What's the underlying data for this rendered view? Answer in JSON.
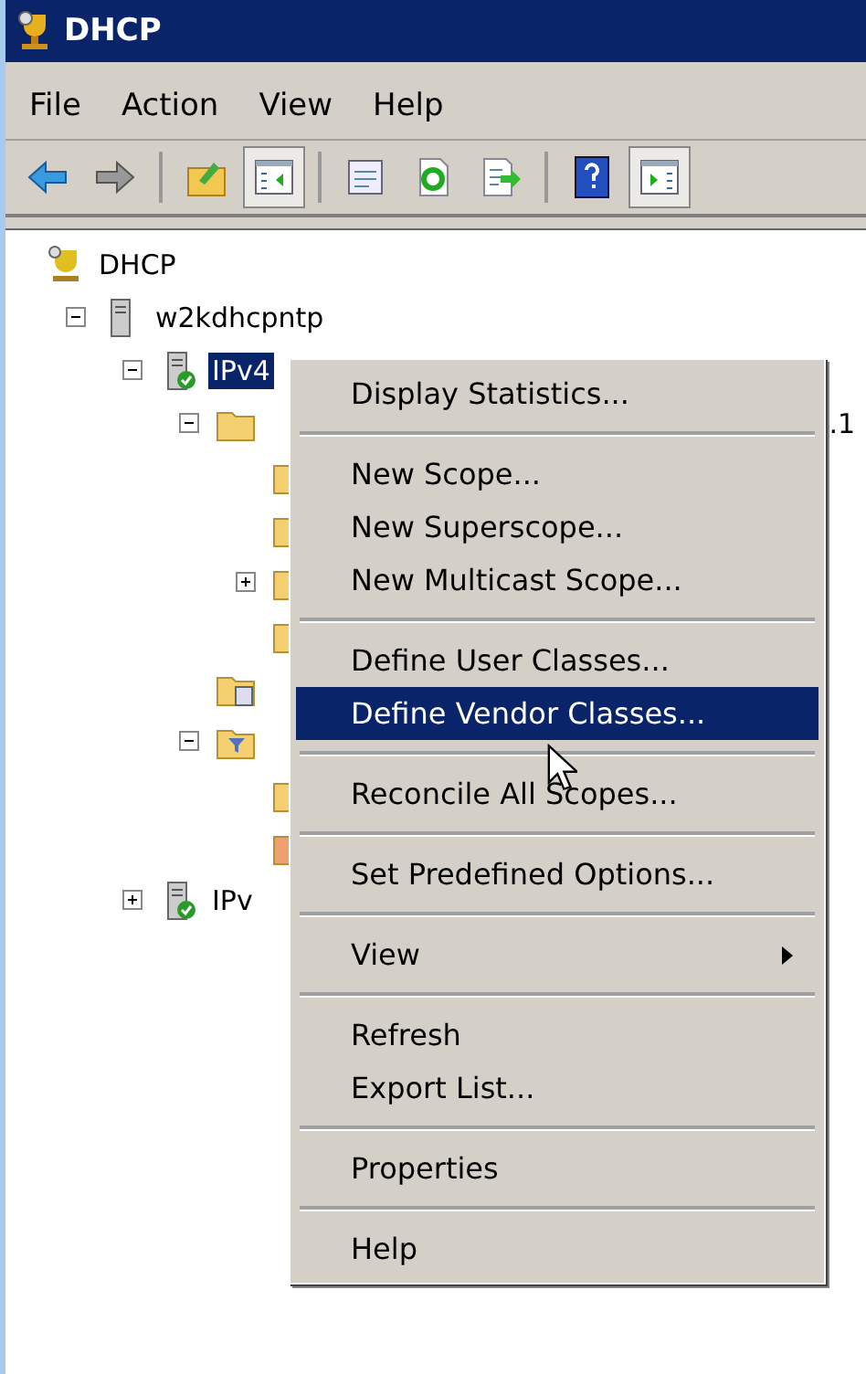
{
  "window": {
    "title": "DHCP"
  },
  "menu_bar": [
    "File",
    "Action",
    "View",
    "Help"
  ],
  "toolbar": [
    {
      "kind": "back",
      "pressed": false
    },
    {
      "kind": "forward",
      "pressed": false
    },
    {
      "kind": "separator"
    },
    {
      "kind": "up",
      "pressed": false
    },
    {
      "kind": "tree",
      "pressed": true
    },
    {
      "kind": "separator"
    },
    {
      "kind": "properties",
      "pressed": false
    },
    {
      "kind": "refresh",
      "pressed": false
    },
    {
      "kind": "export",
      "pressed": false
    },
    {
      "kind": "separator"
    },
    {
      "kind": "help",
      "pressed": false
    },
    {
      "kind": "pane",
      "pressed": true
    }
  ],
  "tree": [
    {
      "label": "DHCP",
      "kind": "dhcp",
      "selected": false,
      "children": [
        {
          "label": "w2kdhcpntp",
          "kind": "server",
          "expanded": true,
          "selected": false,
          "children": [
            {
              "label": "IPv4",
              "kind": "protocol",
              "expanded": true,
              "selected": true,
              "children": [
                {
                  "label": ".1",
                  "kind": "scope",
                  "expanded": true,
                  "selected": false,
                  "children": [
                    {
                      "kind": "folder"
                    },
                    {
                      "kind": "folder"
                    },
                    {
                      "kind": "folder",
                      "expanded": false
                    },
                    {
                      "kind": "folder"
                    }
                  ]
                },
                {
                  "kind": "options"
                },
                {
                  "kind": "filters",
                  "expanded": true,
                  "children": [
                    {
                      "kind": "folder"
                    },
                    {
                      "kind": "policy"
                    }
                  ]
                }
              ]
            },
            {
              "label": "IPv",
              "kind": "protocol",
              "expanded": false,
              "selected": false
            }
          ]
        }
      ]
    }
  ],
  "context_menu": [
    {
      "kind": "item",
      "label": "Display Statistics...",
      "selected": false
    },
    {
      "kind": "separator"
    },
    {
      "kind": "item",
      "label": "New Scope...",
      "selected": false
    },
    {
      "kind": "item",
      "label": "New Superscope...",
      "selected": false
    },
    {
      "kind": "item",
      "label": "New Multicast Scope...",
      "selected": false
    },
    {
      "kind": "separator"
    },
    {
      "kind": "item",
      "label": "Define User Classes...",
      "selected": false
    },
    {
      "kind": "item",
      "label": "Define Vendor Classes...",
      "selected": true
    },
    {
      "kind": "separator"
    },
    {
      "kind": "item",
      "label": "Reconcile All Scopes...",
      "selected": false
    },
    {
      "kind": "separator"
    },
    {
      "kind": "item",
      "label": "Set Predefined Options...",
      "selected": false
    },
    {
      "kind": "separator"
    },
    {
      "kind": "item",
      "label": "View",
      "selected": false,
      "submenu": true
    },
    {
      "kind": "separator"
    },
    {
      "kind": "item",
      "label": "Refresh",
      "selected": false
    },
    {
      "kind": "item",
      "label": "Export List...",
      "selected": false
    },
    {
      "kind": "separator"
    },
    {
      "kind": "item",
      "label": "Properties",
      "selected": false
    },
    {
      "kind": "separator"
    },
    {
      "kind": "item",
      "label": "Help",
      "selected": false
    }
  ]
}
